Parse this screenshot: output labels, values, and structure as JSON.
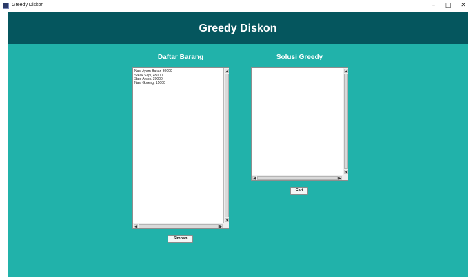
{
  "window": {
    "title": "Greedy Diskon",
    "minimize_icon": "minimize-icon",
    "maximize_icon": "maximize-icon",
    "close_icon": "close-icon",
    "minimize_glyph": "–",
    "maximize_glyph": "□",
    "close_glyph": "✕"
  },
  "header": {
    "title": "Greedy Diskon"
  },
  "left_panel": {
    "title": "Daftar Barang",
    "text": "Nasi Ayam Bakar, 30000\nSteak Sapi, 45000\nSate Ayam, 20000\nNasi Goreng, 15000",
    "button_label": "Simpan"
  },
  "right_panel": {
    "title": "Solusi Greedy",
    "text": "",
    "button_label": "Cari"
  },
  "scroll_glyphs": {
    "up": "▲",
    "down": "▼",
    "left": "◀",
    "right": "▶"
  },
  "colors": {
    "background": "#21b2aa",
    "header": "#05565e",
    "text_light": "#ffffff"
  }
}
